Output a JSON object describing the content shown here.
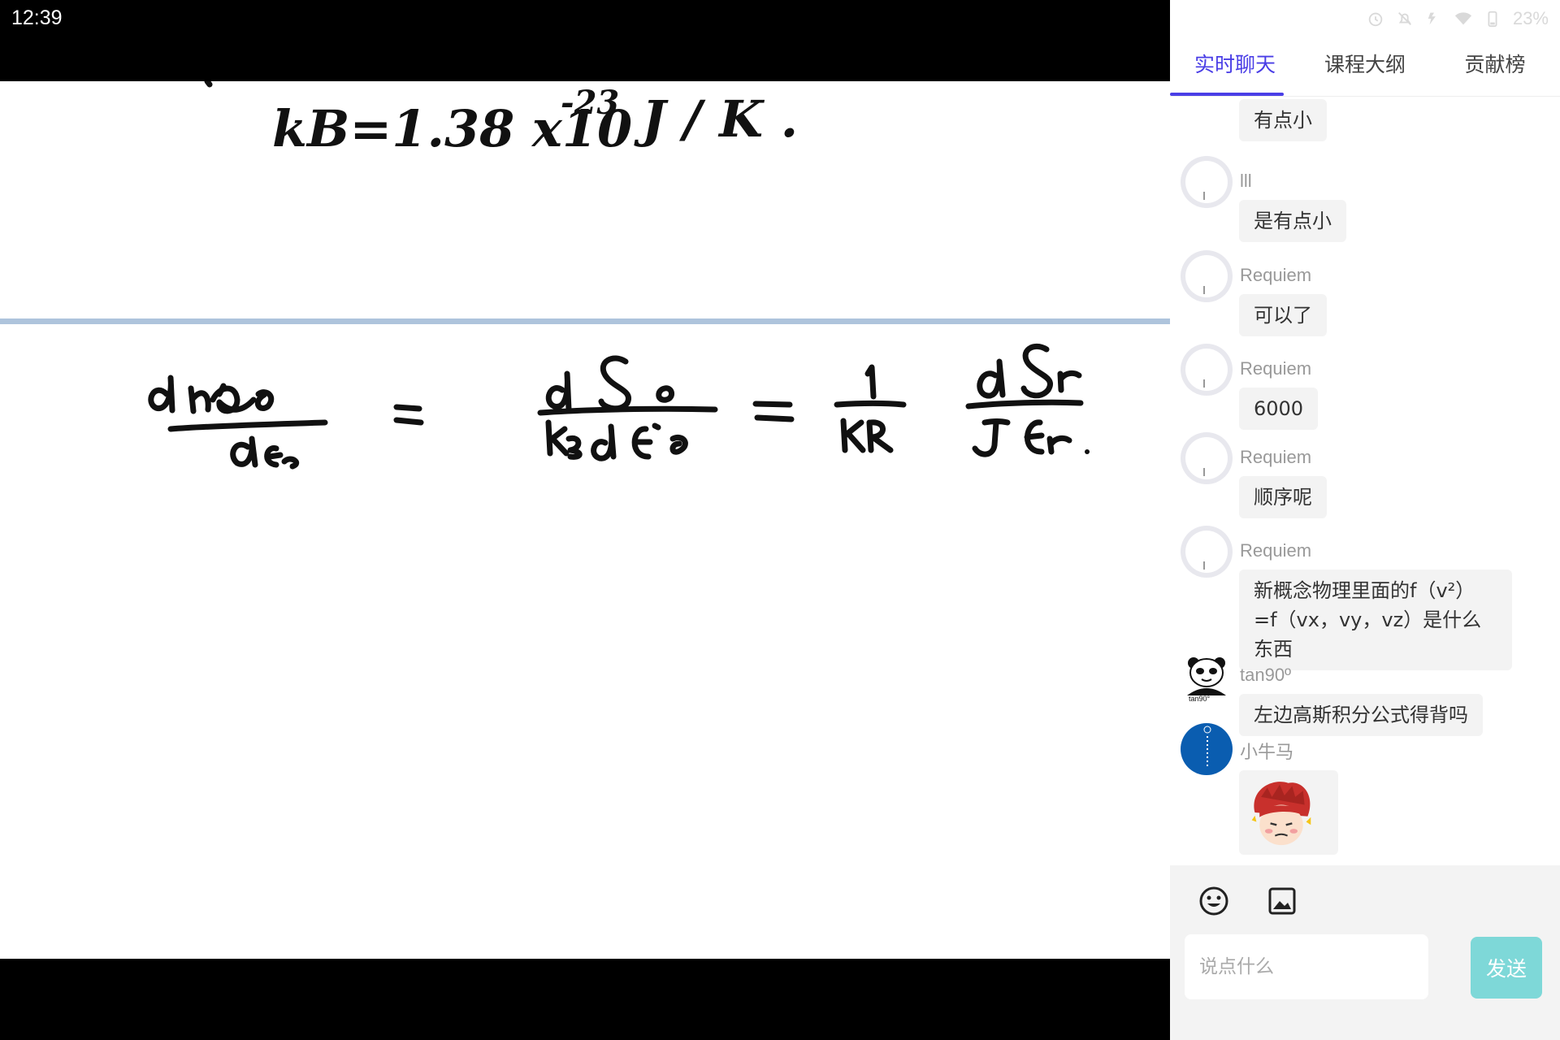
{
  "statusbar": {
    "time": "12:39",
    "battery": "23%"
  },
  "board": {
    "line1_left": "kB=1.38 x10",
    "line1_exp": "-23",
    "line1_right": "J / K ."
  },
  "tabs": [
    {
      "label": "实时聊天",
      "active": true
    },
    {
      "label": "课程大纲",
      "active": false
    },
    {
      "label": "贡献榜",
      "active": false
    }
  ],
  "messages": [
    {
      "type": "bubble-only",
      "text": "有点小"
    },
    {
      "user": "lll",
      "text": "是有点小"
    },
    {
      "user": "Requiem",
      "text": "可以了"
    },
    {
      "user": "Requiem",
      "text": "6000"
    },
    {
      "user": "Requiem",
      "text": "顺序呢"
    },
    {
      "user": "Requiem",
      "text": "新概念物理里面的f（v²）=f（vx，vy，vz）是什么东西"
    },
    {
      "user": "tan90º",
      "avatar_caption": "tan90°",
      "text": "左边高斯积分公式得背吗"
    },
    {
      "user": "小牛马",
      "sticker": "cartoon-face-sticker"
    }
  ],
  "input": {
    "placeholder": "说点什么",
    "send_label": "发送"
  },
  "colors": {
    "accent": "#4a3ee6",
    "send": "#7ed8d8"
  }
}
